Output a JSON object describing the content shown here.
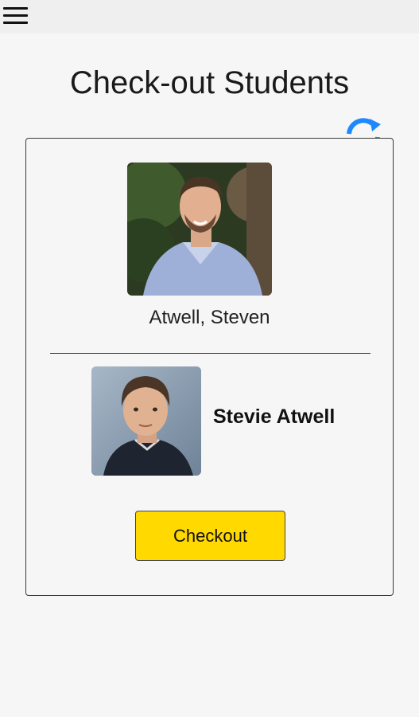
{
  "header": {
    "menu_icon": "hamburger-menu-icon"
  },
  "page": {
    "title": "Check-out Students",
    "refresh_icon": "refresh-icon"
  },
  "colors": {
    "accent_blue": "#1e88ff",
    "button_yellow": "#ffd900",
    "background": "#f6f6f6"
  },
  "parent": {
    "name": "Atwell, Steven",
    "photo": "parent-photo"
  },
  "student": {
    "name": "Stevie Atwell",
    "photo": "student-photo"
  },
  "actions": {
    "checkout_label": "Checkout"
  }
}
